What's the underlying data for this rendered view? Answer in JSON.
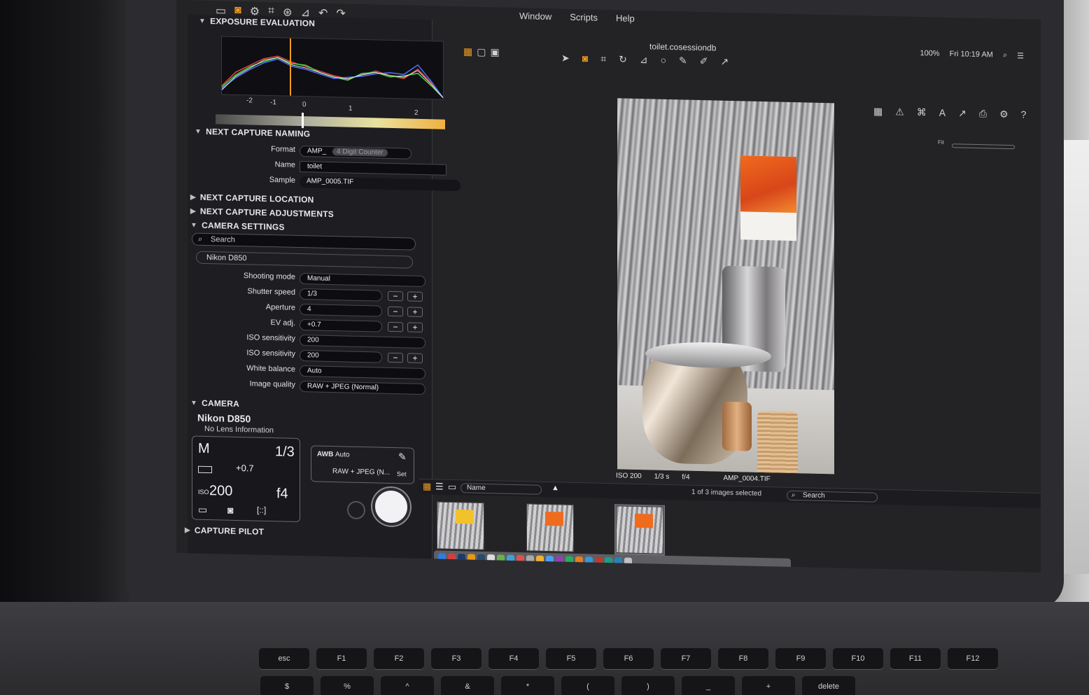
{
  "menubar": {
    "items": [
      "Window",
      "Scripts",
      "Help"
    ],
    "battery": "100%",
    "clock": "Fri 10:19 AM"
  },
  "viewer": {
    "document_title": "toilet.cosessiondb",
    "fit_label": "Fit",
    "image_info": {
      "iso": "ISO 200",
      "shutter": "1/3 s",
      "aperture": "f/4",
      "filename": "AMP_0004.TIF"
    }
  },
  "panel": {
    "exposure": {
      "title": "EXPOSURE EVALUATION",
      "ev_labels": [
        "-2",
        "-1",
        "0",
        "1",
        "2"
      ],
      "ev_marker": -0.7
    },
    "naming": {
      "title": "NEXT CAPTURE NAMING",
      "format_label": "Format",
      "format_value": "AMP_",
      "format_token": "4 Digit Counter",
      "name_label": "Name",
      "name_value": "toilet",
      "sample_label": "Sample",
      "sample_value": "AMP_0005.TIF"
    },
    "location_title": "NEXT CAPTURE LOCATION",
    "adjustments_title": "NEXT CAPTURE ADJUSTMENTS",
    "camera_settings": {
      "title": "CAMERA SETTINGS",
      "search_placeholder": "Search",
      "device": "Nikon D850",
      "rows": [
        {
          "label": "Shooting mode",
          "value": "Manual"
        },
        {
          "label": "Shutter speed",
          "value": "1/3"
        },
        {
          "label": "Aperture",
          "value": "4"
        },
        {
          "label": "EV adj.",
          "value": "+0.7"
        },
        {
          "label": "ISO sensitivity",
          "value": "200"
        },
        {
          "label": "ISO sensitivity",
          "value": "200"
        },
        {
          "label": "White balance",
          "value": "Auto"
        },
        {
          "label": "Image quality",
          "value": "RAW + JPEG (Normal)"
        }
      ]
    },
    "camera": {
      "title": "CAMERA",
      "model": "Nikon D850",
      "lens": "No Lens Information",
      "mode": "M",
      "shutter": "1/3",
      "ev": "+0.7",
      "iso": "200",
      "iso_prefix": "ISO",
      "aperture": "f4",
      "wb": "Auto",
      "wb_icon": "AWB",
      "quality": "RAW + JPEG (N...",
      "set_label": "Set"
    },
    "capture_pilot_title": "CAPTURE PILOT"
  },
  "browser": {
    "sort_field": "Name",
    "selection": "1 of 3 images selected",
    "search_placeholder": "Search",
    "thumb_count": 3
  },
  "keyboard": {
    "row1": [
      "esc",
      "F1",
      "F2",
      "F3",
      "F4",
      "F5",
      "F6",
      "F7",
      "F8",
      "F9",
      "F10",
      "F11",
      "F12"
    ],
    "row2": [
      "$",
      "%",
      "^",
      "&",
      "*",
      "(",
      ")",
      "_",
      "+",
      "delete"
    ]
  },
  "colors": {
    "accent": "#f39a1e",
    "panel_bg": "#1e1d21",
    "viewer_bg": "#232225"
  }
}
